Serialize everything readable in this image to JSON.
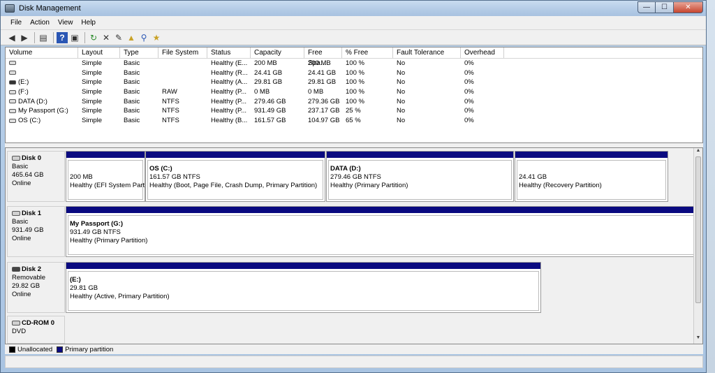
{
  "window": {
    "title": "Disk Management",
    "caption": {
      "minimize": "—",
      "maximize": "☐",
      "close": "✕"
    }
  },
  "menu": [
    "File",
    "Action",
    "View",
    "Help"
  ],
  "toolbar": {
    "icons": [
      "back-arrow-icon",
      "forward-arrow-icon",
      "console-tree-icon",
      "help-icon",
      "help-topic-icon",
      "refresh-icon",
      "delete-icon",
      "properties-icon",
      "open-icon",
      "search-icon",
      "wizard-icon"
    ]
  },
  "volume_table": {
    "headers": [
      "Volume",
      "Layout",
      "Type",
      "File System",
      "Status",
      "Capacity",
      "Free Spa...",
      "% Free",
      "Fault Tolerance",
      "Overhead"
    ],
    "rows": [
      [
        "",
        "Simple",
        "Basic",
        "",
        "Healthy (E...",
        "200 MB",
        "200 MB",
        "100 %",
        "No",
        "0%"
      ],
      [
        "",
        "Simple",
        "Basic",
        "",
        "Healthy (R...",
        "24.41 GB",
        "24.41 GB",
        "100 %",
        "No",
        "0%"
      ],
      [
        "(E:)",
        "Simple",
        "Basic",
        "",
        "Healthy (A...",
        "29.81 GB",
        "29.81 GB",
        "100 %",
        "No",
        "0%"
      ],
      [
        "(F:)",
        "Simple",
        "Basic",
        "RAW",
        "Healthy (P...",
        "0 MB",
        "0 MB",
        "100 %",
        "No",
        "0%"
      ],
      [
        "DATA (D:)",
        "Simple",
        "Basic",
        "NTFS",
        "Healthy (P...",
        "279.46 GB",
        "279.36 GB",
        "100 %",
        "No",
        "0%"
      ],
      [
        "My Passport (G:)",
        "Simple",
        "Basic",
        "NTFS",
        "Healthy (P...",
        "931.49 GB",
        "237.17 GB",
        "25 %",
        "No",
        "0%"
      ],
      [
        "OS (C:)",
        "Simple",
        "Basic",
        "NTFS",
        "Healthy (B...",
        "161.57 GB",
        "104.97 GB",
        "65 %",
        "No",
        "0%"
      ]
    ]
  },
  "disks": [
    {
      "name": "Disk 0",
      "type": "Basic",
      "size": "465.64 GB",
      "status": "Online",
      "partitions": [
        {
          "title": "",
          "size": "200 MB",
          "status": "Healthy (EFI System Part"
        },
        {
          "title": "OS  (C:)",
          "size": "161.57 GB NTFS",
          "status": "Healthy (Boot, Page File, Crash Dump, Primary Partition)"
        },
        {
          "title": "DATA  (D:)",
          "size": "279.46 GB NTFS",
          "status": "Healthy (Primary Partition)"
        },
        {
          "title": "",
          "size": "24.41 GB",
          "status": "Healthy (Recovery Partition)"
        }
      ]
    },
    {
      "name": "Disk 1",
      "type": "Basic",
      "size": "931.49 GB",
      "status": "Online",
      "partitions": [
        {
          "title": "My Passport  (G:)",
          "size": "931.49 GB NTFS",
          "status": "Healthy (Primary Partition)"
        }
      ]
    },
    {
      "name": "Disk 2",
      "type": "Removable",
      "size": "29.82 GB",
      "status": "Online",
      "partitions": [
        {
          "title": "(E:)",
          "size": "29.81 GB",
          "status": "Healthy (Active, Primary Partition)"
        }
      ]
    },
    {
      "name": "CD-ROM 0",
      "type": "DVD",
      "size": "",
      "status": "",
      "partitions": []
    }
  ],
  "legend": [
    {
      "label": "Unallocated",
      "color": "#000000"
    },
    {
      "label": "Primary partition",
      "color": "#0a0a80"
    }
  ]
}
